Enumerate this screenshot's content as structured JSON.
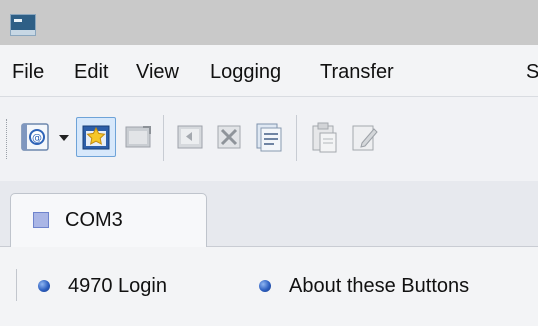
{
  "window": {
    "app_icon": "terminal-app-icon"
  },
  "menu": {
    "items": [
      {
        "label": "File"
      },
      {
        "label": "Edit"
      },
      {
        "label": "View"
      },
      {
        "label": "Logging"
      },
      {
        "label": "Transfer"
      },
      {
        "label": "S"
      }
    ]
  },
  "toolbar": {
    "buttons": [
      {
        "icon": "connect-icon"
      },
      {
        "icon": "dropdown-arrow-icon"
      },
      {
        "icon": "new-session-star-icon",
        "state": "active"
      },
      {
        "icon": "quick-connect-icon",
        "state": "disabled"
      },
      {
        "icon": "reconnect-icon",
        "state": "disabled"
      },
      {
        "icon": "disconnect-icon",
        "state": "disabled"
      },
      {
        "icon": "session-options-icon",
        "state": "disabled"
      },
      {
        "icon": "paste-icon",
        "state": "disabled"
      },
      {
        "icon": "edit-icon",
        "state": "disabled"
      }
    ]
  },
  "tabs": [
    {
      "label": "COM3",
      "icon": "serial-port-icon",
      "active": true
    }
  ],
  "button_bar": {
    "buttons": [
      {
        "label": "4970 Login",
        "icon": "bullet-icon"
      },
      {
        "label": "About these Buttons",
        "icon": "bullet-icon"
      }
    ]
  },
  "colors": {
    "active_button_fill": "#d7e8fb",
    "active_button_border": "#6ea3d8",
    "bullet_blue": "#2d5fc0",
    "tab_icon_blue": "#aab6e6"
  }
}
